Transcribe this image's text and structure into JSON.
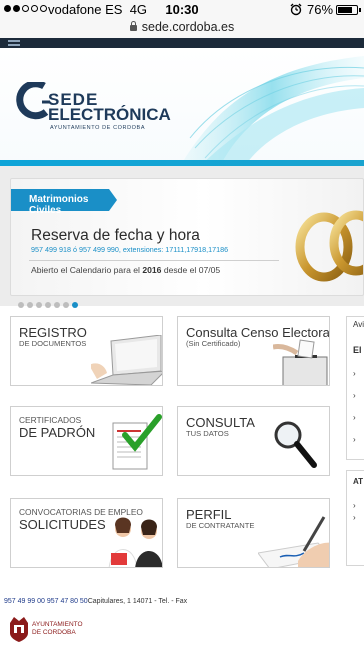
{
  "status_bar": {
    "carrier": "vodafone ES",
    "network": "4G",
    "time": "10:30",
    "battery": "76%",
    "battery_level": 0.76
  },
  "browser": {
    "url": "sede.cordoba.es"
  },
  "header": {
    "logo_line1": "SEDE",
    "logo_line2": "ELECTRÓNICA",
    "logo_line3": "AYUNTAMIENTO DE CORDOBA"
  },
  "slider": {
    "tab_label": "Matrimonios Civiles",
    "title": "Reserva de fecha y hora",
    "phones": "957 499 918 ó 957 499 990, extensiones: 17111,17918,17186",
    "note_prefix": "Abierto el Calendario para el ",
    "note_year": "2016",
    "note_suffix": " desde el 07/05",
    "dots_total": 7,
    "active_dot": 7
  },
  "tiles": [
    {
      "line1": "REGISTRO",
      "line2": "DE DOCUMENTOS"
    },
    {
      "line1": "Consulta Censo Electoral",
      "line2": "(Sin Certificado)"
    },
    {
      "small": "CERTIFICADOS",
      "big": "DE PADRÓN"
    },
    {
      "line1": "CONSULTA",
      "line2": "TUS DATOS"
    },
    {
      "small": "CONVOCATORIAS DE EMPLEO",
      "big": "SOLICITUDES"
    },
    {
      "line1": "PERFIL",
      "line2": "DE CONTRATANTE"
    }
  ],
  "sidebar": {
    "top_label": "Avi",
    "mid_label": "El",
    "bottom_label": "AT"
  },
  "footer": {
    "phones": "957 49 99 00 957 47 80 50",
    "address": "Capitulares, 1 14071 - Tel. - Fax",
    "logo_line1": "AYUNTAMIENTO",
    "logo_line2": "DE CORDOBA"
  },
  "colors": {
    "accent": "#1a8fc7",
    "navy": "#1e3a5a",
    "header_bar": "#1c2a3a",
    "crest_red": "#8b1a1a"
  },
  "icons": [
    "signal-dots-icon",
    "lock-icon",
    "alarm-icon",
    "battery-icon",
    "menu-icon",
    "wedding-rings-image",
    "laptop-image",
    "ballot-box-image",
    "certificate-check-image",
    "magnifier-image",
    "candidates-photo-image",
    "signing-pen-image",
    "city-crest-icon"
  ]
}
